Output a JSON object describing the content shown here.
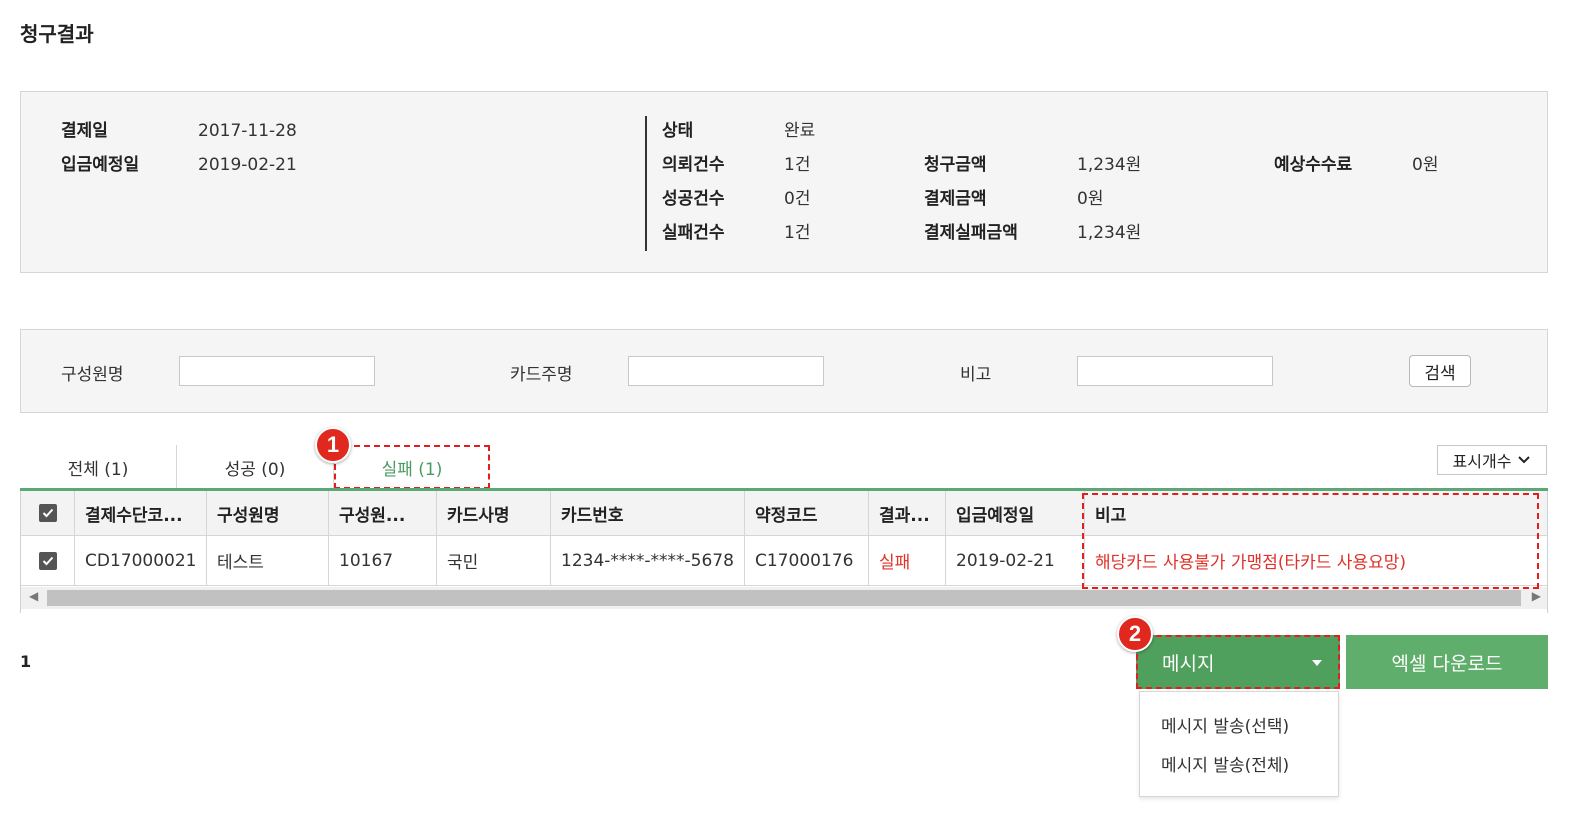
{
  "page": {
    "title": "청구결과"
  },
  "summary": {
    "payment_date_label": "결제일",
    "payment_date": "2017-11-28",
    "deposit_date_label": "입금예정일",
    "deposit_date": "2019-02-21",
    "status_label": "상태",
    "status": "완료",
    "request_count_label": "의뢰건수",
    "request_count": "1건",
    "success_count_label": "성공건수",
    "success_count": "0건",
    "fail_count_label": "실패건수",
    "fail_count": "1건",
    "billed_amount_label": "청구금액",
    "billed_amount": "1,234원",
    "paid_amount_label": "결제금액",
    "paid_amount": "0원",
    "failed_amount_label": "결제실패금액",
    "failed_amount": "1,234원",
    "expected_fee_label": "예상수수료",
    "expected_fee": "0원"
  },
  "search": {
    "member_name_label": "구성원명",
    "member_name_value": "",
    "card_owner_label": "카드주명",
    "card_owner_value": "",
    "note_label": "비고",
    "note_value": "",
    "search_button": "검색"
  },
  "tabs": [
    {
      "label": "전체 (1)",
      "active": false
    },
    {
      "label": "성공 (0)",
      "active": false
    },
    {
      "label": "실패 (1)",
      "active": true
    }
  ],
  "page_size": {
    "label": "표시개수"
  },
  "table": {
    "headers": [
      "결제수단코...",
      "구성원명",
      "구성원...",
      "카드사명",
      "카드번호",
      "약정코드",
      "결과...",
      "입금예정일",
      "비고"
    ],
    "rows": [
      [
        "CD17000021",
        "테스트",
        "10167",
        "국민",
        "1234-****-****-5678",
        "C17000176",
        "실패",
        "2019-02-21",
        "해당카드 사용불가 가맹점(타카드 사용요망)"
      ]
    ]
  },
  "pagination": {
    "current": "1"
  },
  "actions": {
    "message_button": "메시지",
    "excel_button": "엑셀 다운로드",
    "message_menu": [
      "메시지 발송(선택)",
      "메시지 발송(전체)"
    ]
  },
  "annotations": {
    "badge1": "1",
    "badge2": "2"
  },
  "colors": {
    "accent_green": "#5aa876",
    "button_green": "#4f9f5d",
    "error_red": "#e0322a",
    "annotation_red": "#e02020"
  }
}
